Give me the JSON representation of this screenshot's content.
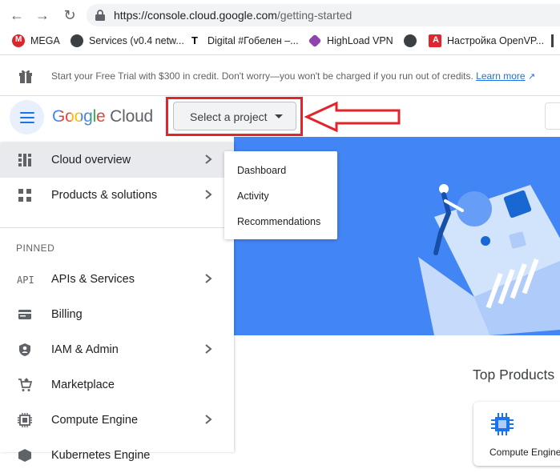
{
  "browser": {
    "url_host": "https://console.cloud.google.com",
    "url_path": "/getting-started",
    "bookmarks": [
      {
        "label": "MEGA"
      },
      {
        "label": "Services (v0.4 netw..."
      },
      {
        "label": "Digital #Гобелен –..."
      },
      {
        "label": "HighLoad VPN"
      },
      {
        "label": "Настройка OpenVP..."
      }
    ]
  },
  "trial_banner": {
    "text": "Start your Free Trial with $300 in credit. Don't worry—you won't be charged if you run out of credits.",
    "learn_more": "Learn more"
  },
  "header": {
    "logo_google": "Google",
    "logo_cloud": "Cloud",
    "project_selector": "Select a project"
  },
  "sidebar": {
    "top_items": [
      {
        "label": "Cloud overview",
        "icon": "dashboard-icon",
        "has_submenu": true
      },
      {
        "label": "Products & solutions",
        "icon": "grid-icon",
        "has_submenu": true
      }
    ],
    "pinned_heading": "PINNED",
    "pinned_items": [
      {
        "label": "APIs & Services",
        "icon": "api-icon",
        "has_submenu": true
      },
      {
        "label": "Billing",
        "icon": "billing-icon",
        "has_submenu": false
      },
      {
        "label": "IAM & Admin",
        "icon": "shield-icon",
        "has_submenu": true
      },
      {
        "label": "Marketplace",
        "icon": "cart-icon",
        "has_submenu": false
      },
      {
        "label": "Compute Engine",
        "icon": "chip-icon",
        "has_submenu": true
      },
      {
        "label": "Kubernetes Engine",
        "icon": "kubernetes-icon",
        "has_submenu": true
      }
    ]
  },
  "submenu": {
    "items": [
      "Dashboard",
      "Activity",
      "Recommendations"
    ]
  },
  "main": {
    "top_products_heading": "Top Products",
    "first_product": "Compute Engine"
  },
  "colors": {
    "accent": "#1a73e8",
    "hero_bg": "#4285f4",
    "annotation_red": "#e3242b"
  }
}
